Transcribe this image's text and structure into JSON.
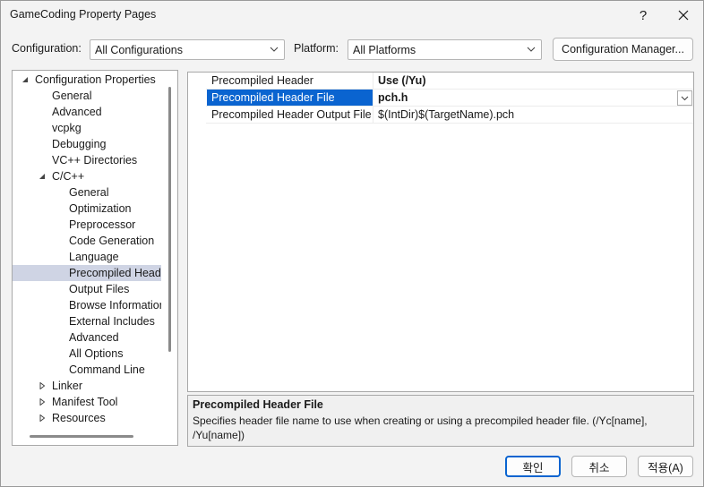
{
  "window": {
    "title": "GameCoding Property Pages",
    "help_label": "?",
    "close_label": "✕"
  },
  "toolbar": {
    "configuration_label": "Configuration:",
    "configuration_value": "All Configurations",
    "platform_label": "Platform:",
    "platform_value": "All Platforms",
    "configuration_manager_label": "Configuration Manager..."
  },
  "tree": {
    "items": [
      {
        "label": "Configuration Properties",
        "level": 0,
        "toggle": "expanded"
      },
      {
        "label": "General",
        "level": 1,
        "toggle": "none"
      },
      {
        "label": "Advanced",
        "level": 1,
        "toggle": "none"
      },
      {
        "label": "vcpkg",
        "level": 1,
        "toggle": "none"
      },
      {
        "label": "Debugging",
        "level": 1,
        "toggle": "none"
      },
      {
        "label": "VC++ Directories",
        "level": 1,
        "toggle": "none"
      },
      {
        "label": "C/C++",
        "level": 1,
        "toggle": "expanded"
      },
      {
        "label": "General",
        "level": 2,
        "toggle": "none"
      },
      {
        "label": "Optimization",
        "level": 2,
        "toggle": "none"
      },
      {
        "label": "Preprocessor",
        "level": 2,
        "toggle": "none"
      },
      {
        "label": "Code Generation",
        "level": 2,
        "toggle": "none"
      },
      {
        "label": "Language",
        "level": 2,
        "toggle": "none"
      },
      {
        "label": "Precompiled Headers",
        "level": 2,
        "toggle": "none",
        "selected": true
      },
      {
        "label": "Output Files",
        "level": 2,
        "toggle": "none"
      },
      {
        "label": "Browse Information",
        "level": 2,
        "toggle": "none"
      },
      {
        "label": "External Includes",
        "level": 2,
        "toggle": "none"
      },
      {
        "label": "Advanced",
        "level": 2,
        "toggle": "none"
      },
      {
        "label": "All Options",
        "level": 2,
        "toggle": "none"
      },
      {
        "label": "Command Line",
        "level": 2,
        "toggle": "none"
      },
      {
        "label": "Linker",
        "level": 1,
        "toggle": "collapsed"
      },
      {
        "label": "Manifest Tool",
        "level": 1,
        "toggle": "collapsed"
      },
      {
        "label": "Resources",
        "level": 1,
        "toggle": "collapsed"
      }
    ]
  },
  "grid": {
    "rows": [
      {
        "name": "Precompiled Header",
        "value": "Use (/Yu)",
        "bold": true
      },
      {
        "name": "Precompiled Header File",
        "value": "pch.h",
        "bold": true,
        "selected": true
      },
      {
        "name": "Precompiled Header Output File",
        "value": "$(IntDir)$(TargetName).pch",
        "bold": false
      }
    ]
  },
  "description": {
    "title": "Precompiled Header File",
    "text": "Specifies header file name to use when creating or using a precompiled header file. (/Yc[name], /Yu[name])"
  },
  "footer": {
    "ok_label": "확인",
    "cancel_label": "취소",
    "apply_label": "적용(A)"
  },
  "colors": {
    "selection_blue": "#0a64d0",
    "tree_selection": "#cfd4e4",
    "background": "#f3f3f3"
  }
}
